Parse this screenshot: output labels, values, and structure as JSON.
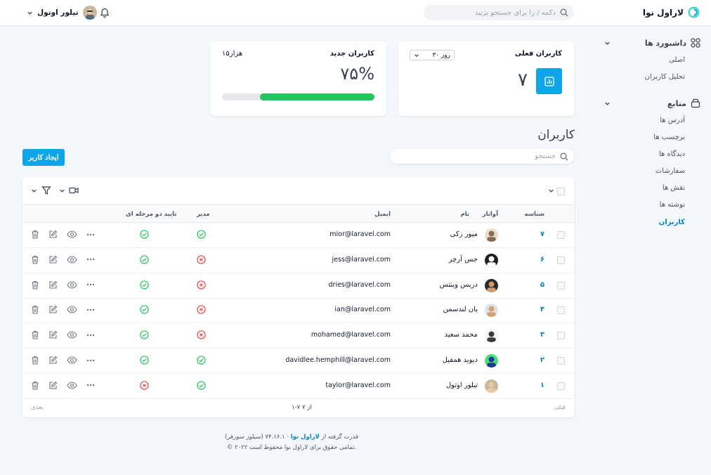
{
  "app": {
    "brand_name": "لاراول نوا"
  },
  "header": {
    "search_placeholder": "دکمه / را برای جستجو بزنید",
    "user_name": "تیلور اوتول"
  },
  "sidebar": {
    "groups": [
      {
        "label": "داشبورد ها",
        "icon": "grid-icon",
        "items": [
          "اصلی",
          "تحلیل کاربران"
        ]
      },
      {
        "label": "منابع",
        "icon": "database-icon",
        "items": [
          "آدرس ها",
          "برچسب ها",
          "دیدگاه ها",
          "سفارشات",
          "نقش ها",
          "نوشته ها",
          "کاربران"
        ]
      }
    ],
    "active_item": "کاربران"
  },
  "metrics": {
    "current_users": {
      "title": "کاربران فعلی",
      "value": "۷",
      "range": "۳۰ روز",
      "icon": "chart-icon"
    },
    "new_users": {
      "title": "کاربران جدید",
      "percent": "۷۵%",
      "target": "۱۵هزار",
      "progress": 0.75
    }
  },
  "users": {
    "heading": "کاربران",
    "search_placeholder": "جستجو",
    "create_button": "ایجاد کاربر",
    "columns": {
      "id": "شناسه",
      "avatar": "آواتار",
      "name": "نام",
      "email": "ایمیل",
      "admin": "مدیر",
      "two_factor": "تایید دو مرحله ای"
    },
    "rows": [
      {
        "id": "۷",
        "name": "میور زکی",
        "email": "mior@laravel.com",
        "admin": true,
        "two_factor": true
      },
      {
        "id": "۶",
        "name": "جس آرچر",
        "email": "jess@laravel.com",
        "admin": false,
        "two_factor": true
      },
      {
        "id": "۵",
        "name": "دریس وینتس",
        "email": "dries@laravel.com",
        "admin": false,
        "two_factor": true
      },
      {
        "id": "۴",
        "name": "یان لندسمن",
        "email": "ian@laravel.com",
        "admin": false,
        "two_factor": true
      },
      {
        "id": "۳",
        "name": "محمد سعید",
        "email": "mohamed@laravel.com",
        "admin": false,
        "two_factor": true
      },
      {
        "id": "۲",
        "name": "دیوید همفیل",
        "email": "davidlee.hemphill@laravel.com",
        "admin": true,
        "two_factor": true
      },
      {
        "id": "۱",
        "name": "تیلور اوتول",
        "email": "taylor@laravel.com",
        "admin": true,
        "two_factor": false
      }
    ],
    "pagination": {
      "prev": "قبلی",
      "next": "بعدی",
      "count": "۱-۷ از ۷"
    }
  },
  "footer": {
    "powered_prefix": "قدرت گرفته از",
    "powered_link": "لاراول نوا",
    "version": "· ۷۴.۱۶.۱ (سیلور سورفر)",
    "copyright": "© ۲۰۲۲ تمامی حقوق برای لاراول نوا محفوظ است."
  },
  "colors": {
    "accent": "#0ea5e9",
    "success": "#22c55e",
    "danger": "#ef4444"
  }
}
